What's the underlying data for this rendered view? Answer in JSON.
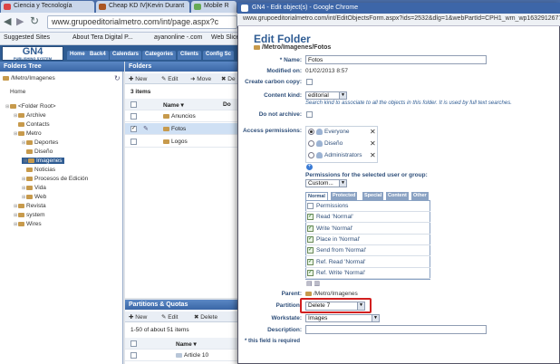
{
  "browser": {
    "tabs": [
      {
        "label": "Ciencia y Tecnología",
        "color": "#d44"
      },
      {
        "label": "Cheap KD IV|Kevin Durant",
        "color": "#a52"
      },
      {
        "label": "Mobile R",
        "color": "#6a5"
      }
    ],
    "tab_close": "×",
    "address": "www.grupoeditorialmetro.com/int/page.aspx?c",
    "bookmarks": [
      "Suggested Sites",
      "About Tera Digital P...",
      "ayanonline -.com",
      "Web Slice"
    ]
  },
  "app": {
    "logo": "GN4",
    "logo_sub": "PUBLISHING SYSTEM",
    "nav": [
      "Home",
      "Back4",
      "Calendars",
      "Categories",
      "Clients",
      "Config Sc"
    ],
    "folders_tree_title": "Folders Tree",
    "current_path": "/Metro/Imagenes",
    "tree": [
      {
        "label": "Home",
        "indent": 0,
        "expand": "",
        "sel": false
      },
      {
        "label": "<Folder Root>",
        "indent": 0,
        "expand": "▣",
        "sel": false
      },
      {
        "label": "Archive",
        "indent": 1,
        "expand": "▣",
        "sel": false
      },
      {
        "label": "Contacts",
        "indent": 1,
        "expand": "",
        "sel": false
      },
      {
        "label": "Metro",
        "indent": 1,
        "expand": "▣",
        "sel": false
      },
      {
        "label": "Deportes",
        "indent": 2,
        "expand": "▣",
        "sel": false
      },
      {
        "label": "Diseño",
        "indent": 2,
        "expand": "",
        "sel": false
      },
      {
        "label": "Imagenes",
        "indent": 2,
        "expand": "▣",
        "sel": true
      },
      {
        "label": "Noticias",
        "indent": 2,
        "expand": "",
        "sel": false
      },
      {
        "label": "Procesos de Edición",
        "indent": 2,
        "expand": "▣",
        "sel": false
      },
      {
        "label": "Vida",
        "indent": 2,
        "expand": "▣",
        "sel": false
      },
      {
        "label": "Web",
        "indent": 2,
        "expand": "▣",
        "sel": false
      },
      {
        "label": "Revista",
        "indent": 1,
        "expand": "▣",
        "sel": false
      },
      {
        "label": "system",
        "indent": 1,
        "expand": "▣",
        "sel": false
      },
      {
        "label": "Wires",
        "indent": 1,
        "expand": "▣",
        "sel": false
      }
    ],
    "folders_title": "Folders",
    "toolbar": {
      "new": "New",
      "edit": "Edit",
      "move": "Move",
      "del": "De"
    },
    "items_count": "3 items",
    "col_name": "Name ▾",
    "col_by": "Do",
    "folders": [
      "Anuncios",
      "Fotos",
      "Logos"
    ],
    "partitions_title": "Partitions & Quotas",
    "ptoolbar": {
      "new": "New",
      "edit": "Edit",
      "del": "Delete"
    },
    "pcount": "1-50 of about 51 items",
    "pcol": "Name ▾",
    "article": "Article 10"
  },
  "popup": {
    "window_title": "GN4 - Edit object(s) - Google Chrome",
    "url": "www.grupoeditorialmetro.com/int/EditObjectsForm.aspx?ids=2532&dlg=1&webPartId=CPH1_wm_wp1632912677",
    "title": "Edit Folder",
    "path": "/Metro/Imagenes/Fotos",
    "name_label": "* Name:",
    "name_value": "Fotos",
    "modified_label": "Modified on:",
    "modified_value": "01/02/2013 8:57",
    "carbon_label": "Create carbon copy:",
    "content_kind_label": "Content kind:",
    "content_kind_value": "editorial",
    "content_kind_help": "Search kind to associate to all the objects in this folder. It is used by full text searches.",
    "no_archive_label": "Do not archive:",
    "access_label": "Access permissions:",
    "groups": [
      "Everyone",
      "Diseño",
      "Administrators"
    ],
    "perm_selected_label": "Permissions for the selected user or group:",
    "perm_preset": "Custom...",
    "perm_tabs": [
      "Normal",
      "Protected",
      "Special",
      "Content",
      "Other"
    ],
    "perm_rows": [
      {
        "label": "Permissions",
        "checked": false
      },
      {
        "label": "Read 'Normal'",
        "checked": true
      },
      {
        "label": "Write 'Normal'",
        "checked": true
      },
      {
        "label": "Place in 'Normal'",
        "checked": true
      },
      {
        "label": "Send from 'Normal'",
        "checked": true
      },
      {
        "label": "Ref. Read 'Normal'",
        "checked": true
      },
      {
        "label": "Ref. Write 'Normal'",
        "checked": true
      }
    ],
    "parent_label": "Parent:",
    "parent_value": "/Metro/Imagenes",
    "partition_label": "Partition:",
    "partition_value": "Delete 7",
    "workstate_label": "Workstate:",
    "workstate_value": "Images",
    "description_label": "Description:",
    "required_note": "* this field is required",
    "highlight_color": "#d21f1f",
    "accent": "#2f5c93"
  }
}
